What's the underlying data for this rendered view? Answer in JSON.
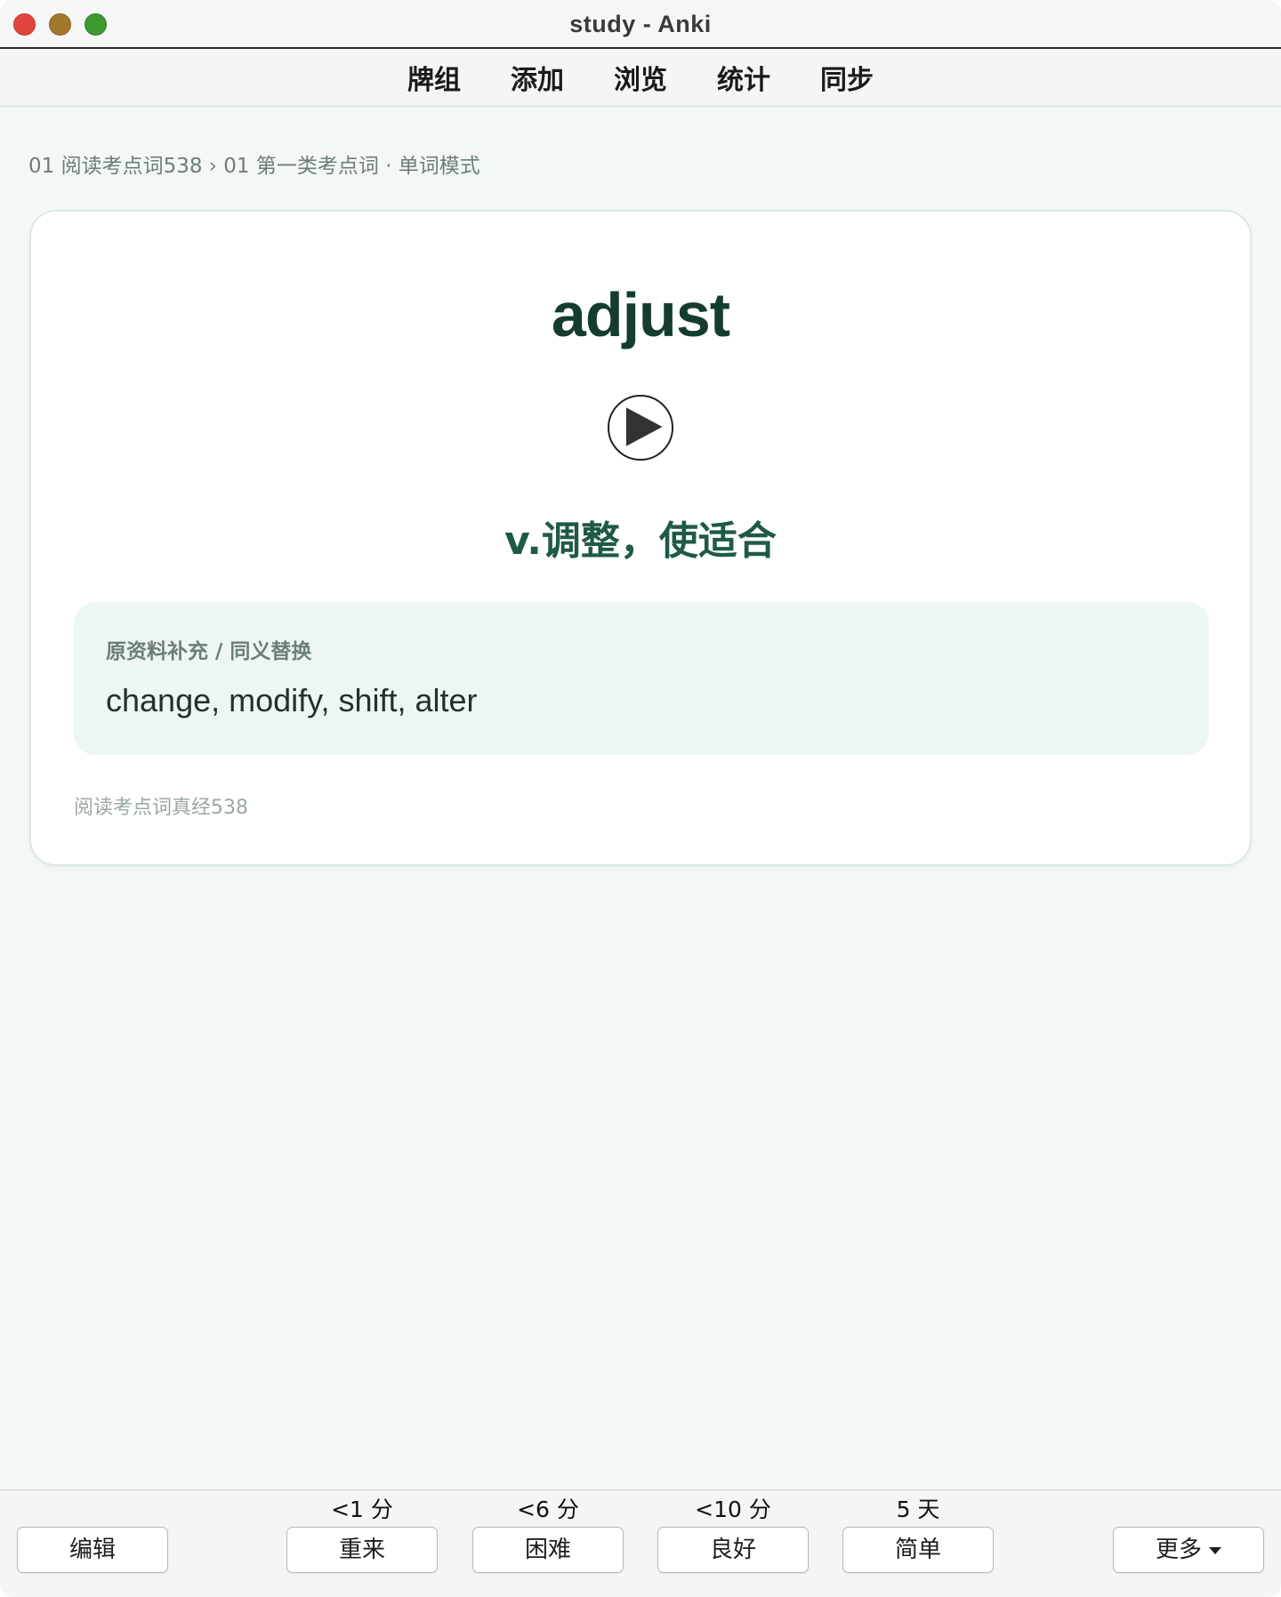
{
  "window": {
    "title": "study - Anki"
  },
  "nav": {
    "items": [
      {
        "label": "牌组"
      },
      {
        "label": "添加"
      },
      {
        "label": "浏览"
      },
      {
        "label": "统计"
      },
      {
        "label": "同步"
      }
    ]
  },
  "breadcrumb": "01 阅读考点词538 › 01 第一类考点词 · 单词模式",
  "card": {
    "word": "adjust",
    "meaning": "v.调整，使适合",
    "supplement_label": "原资料补充 / 同义替换",
    "supplement_text": "change, modify, shift, alter",
    "source": "阅读考点词真经538",
    "audio_icon": "play-icon"
  },
  "bottom": {
    "edit_label": "编辑",
    "more_label": "更多",
    "answers": [
      {
        "interval": "<1 分",
        "label": "重来"
      },
      {
        "interval": "<6 分",
        "label": "困难"
      },
      {
        "interval": "<10 分",
        "label": "良好"
      },
      {
        "interval": "5 天",
        "label": "简单"
      }
    ]
  },
  "colors": {
    "background": "#f3f8f6",
    "word": "#143d2f",
    "meaning": "#1f5a45",
    "supplement_bg": "#edf6f2"
  }
}
